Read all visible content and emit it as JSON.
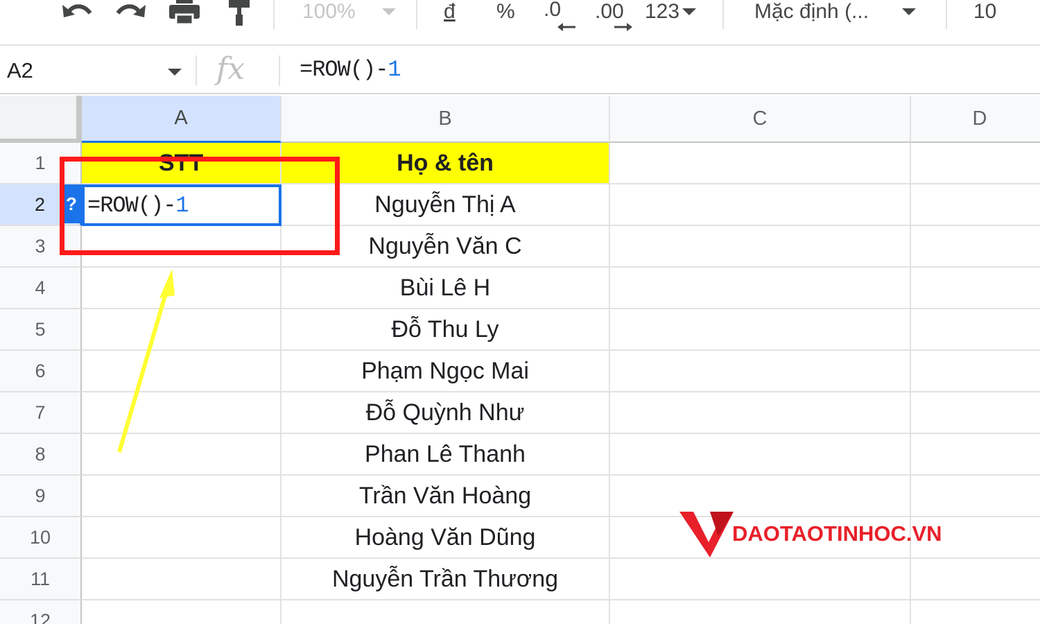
{
  "toolbar": {
    "zoom_value": "100%",
    "currency_label": "đ",
    "percent_label": "%",
    "decrease_decimal_label": ".0",
    "increase_decimal_label": ".00",
    "number_format_label": "123",
    "font_label": "Mặc định (...",
    "font_size": "10"
  },
  "formula_bar": {
    "cell_reference": "A2",
    "fx_label": "fx",
    "formula_prefix": "=ROW()-",
    "formula_number": "1"
  },
  "columns": [
    "A",
    "B",
    "C",
    "D"
  ],
  "rows": [
    "1",
    "2",
    "3",
    "4",
    "5",
    "6",
    "7",
    "8",
    "9",
    "10",
    "11",
    "12"
  ],
  "sheet": {
    "header_a": "STT",
    "header_b": "Họ & tên",
    "edit_formula_prefix": "=ROW()-",
    "edit_formula_number": "1",
    "help_badge": "?",
    "names": [
      "Nguyễn Thị A",
      "Nguyễn Văn C",
      "Bùi Lê H",
      "Đỗ Thu Ly",
      "Phạm Ngọc Mai",
      "Đỗ Quỳnh Như",
      "Phan Lê Thanh",
      "Trần Văn Hoàng",
      "Hoàng Văn Dũng",
      "Nguyễn Trần Thương"
    ]
  },
  "watermark": {
    "text": "DAOTAOTINHOC.VN"
  },
  "colors": {
    "highlight_yellow": "#ffff00",
    "annotation_red": "#ff1a1a",
    "arrow_yellow": "#ffff33",
    "selection_blue": "#1a73e8",
    "watermark_red": "#e8202a"
  }
}
